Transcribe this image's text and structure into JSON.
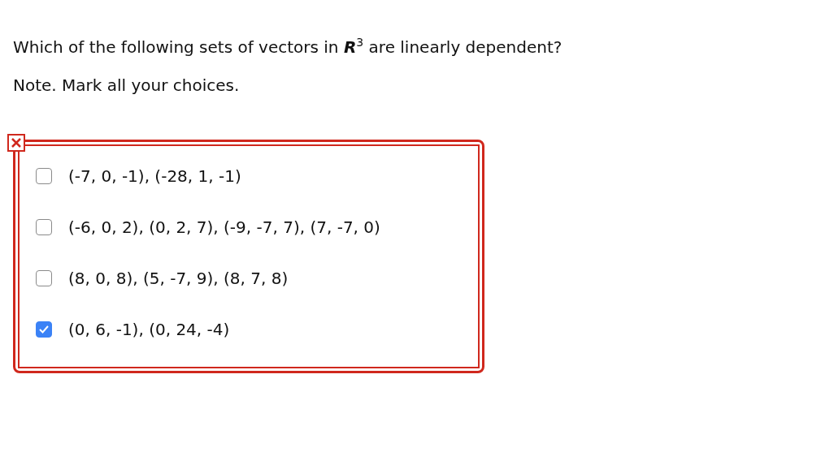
{
  "question": "Which of the following sets of vectors in **R**$^{3}$ are linearly dependent?",
  "note": "Note. Mark all your choices.",
  "answer_correct": false,
  "choices": [
    {
      "label": "(-7, 0, -1), (-28, 1, -1)",
      "checked": false
    },
    {
      "label": "(-6, 0, 2), (0, 2, 7), (-9, -7, 7), (7, -7, 0)",
      "checked": false
    },
    {
      "label": "(8, 0, 8), (5, -7, 9), (8, 7, 8)",
      "checked": false
    },
    {
      "label": "(0, 6, -1), (0, 24, -4)",
      "checked": true
    }
  ]
}
